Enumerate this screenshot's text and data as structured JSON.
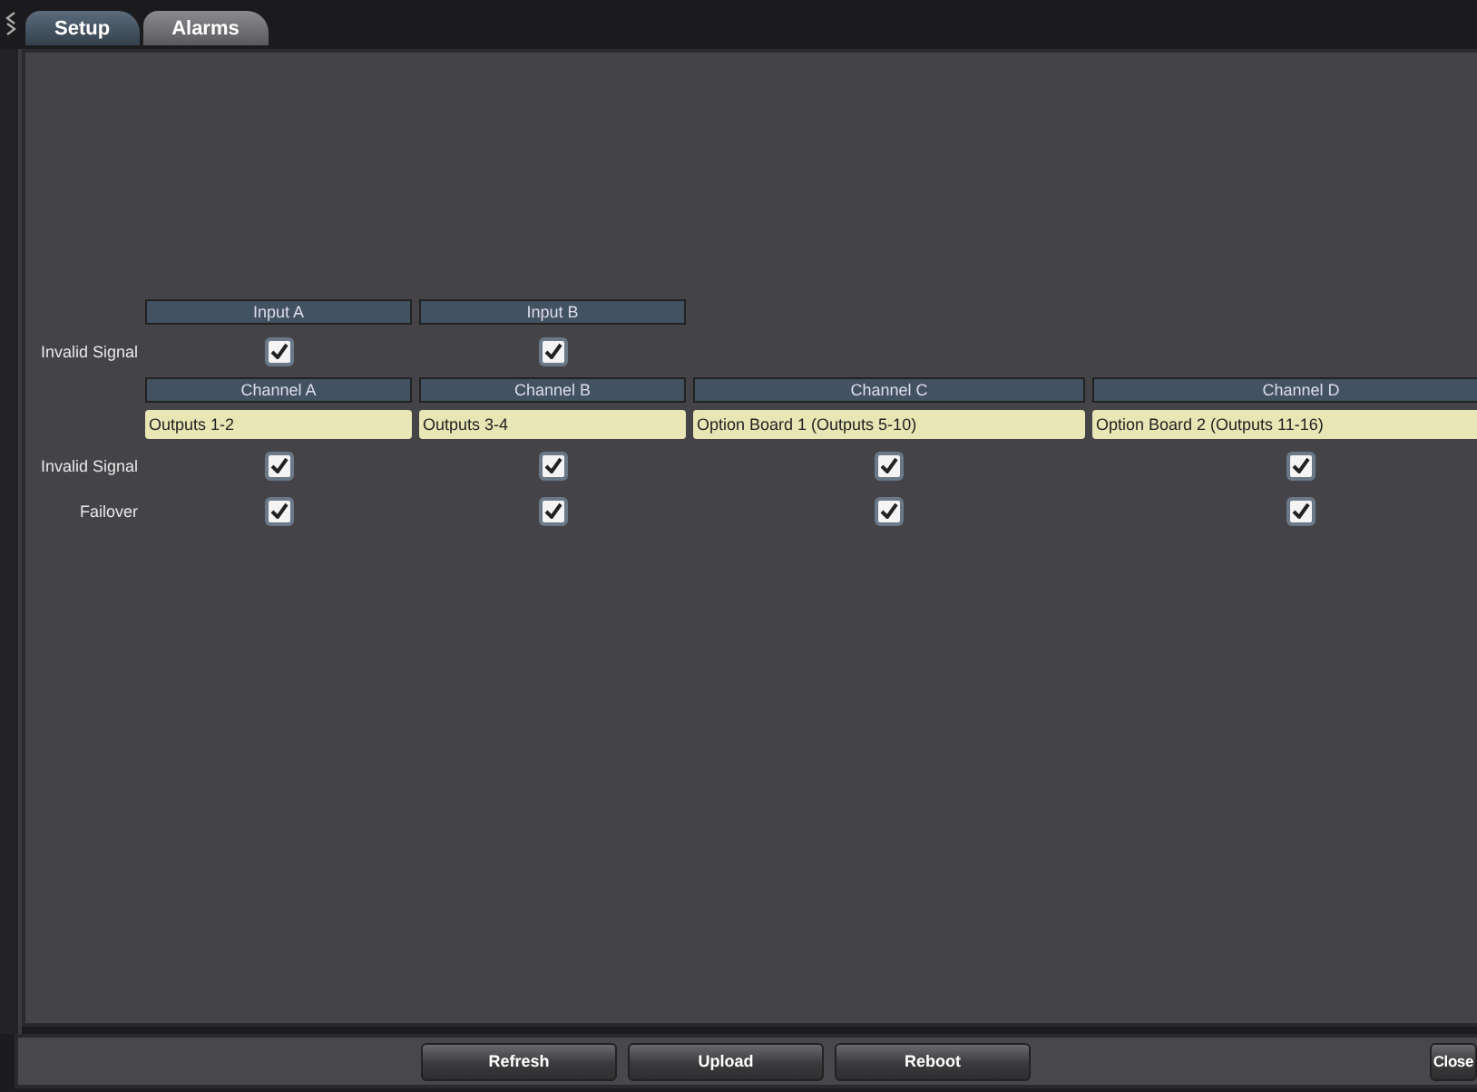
{
  "tabs": [
    {
      "label": "Setup",
      "selected": false
    },
    {
      "label": "Alarms",
      "selected": true
    }
  ],
  "inputs": {
    "columns": [
      "Input A",
      "Input B"
    ],
    "rows": [
      {
        "label": "Invalid Signal",
        "checks": [
          true,
          true
        ]
      }
    ]
  },
  "channels": {
    "columns": [
      {
        "name": "Channel A",
        "outputs": "Outputs 1-2"
      },
      {
        "name": "Channel B",
        "outputs": "Outputs 3-4"
      },
      {
        "name": "Channel C",
        "outputs": "Option Board 1 (Outputs 5-10)"
      },
      {
        "name": "Channel D",
        "outputs": "Option Board 2 (Outputs 11-16)"
      }
    ],
    "rows": [
      {
        "label": "Invalid Signal",
        "checks": [
          true,
          true,
          true,
          true
        ]
      },
      {
        "label": "Failover",
        "checks": [
          true,
          true,
          true,
          true
        ]
      }
    ]
  },
  "buttons": [
    "Refresh",
    "Upload",
    "Reboot"
  ],
  "close_button": "Close"
}
